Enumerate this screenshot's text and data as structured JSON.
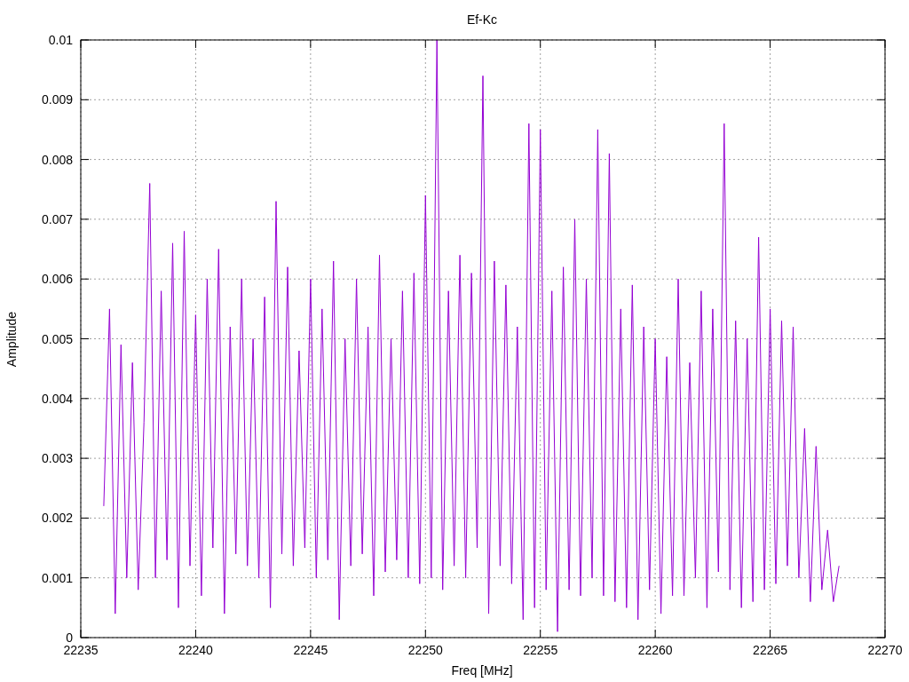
{
  "chart_data": {
    "type": "line",
    "title": "Ef-Kc",
    "xlabel": "Freq [MHz]",
    "ylabel": "Amplitude",
    "xlim": [
      22235,
      22270
    ],
    "ylim": [
      0,
      0.01
    ],
    "xticks": [
      22235,
      22240,
      22245,
      22250,
      22255,
      22260,
      22265,
      22270
    ],
    "yticks": [
      0,
      0.001,
      0.002,
      0.003,
      0.004,
      0.005,
      0.006,
      0.007,
      0.008,
      0.009,
      0.01
    ],
    "grid": true,
    "x": [
      22236,
      22236.25,
      22236.5,
      22236.75,
      22237,
      22237.25,
      22237.5,
      22237.75,
      22238,
      22238.25,
      22238.5,
      22238.75,
      22239,
      22239.25,
      22239.5,
      22239.75,
      22240,
      22240.25,
      22240.5,
      22240.75,
      22241,
      22241.25,
      22241.5,
      22241.75,
      22242,
      22242.25,
      22242.5,
      22242.75,
      22243,
      22243.25,
      22243.5,
      22243.75,
      22244,
      22244.25,
      22244.5,
      22244.75,
      22245,
      22245.25,
      22245.5,
      22245.75,
      22246,
      22246.25,
      22246.5,
      22246.75,
      22247,
      22247.25,
      22247.5,
      22247.75,
      22248,
      22248.25,
      22248.5,
      22248.75,
      22249,
      22249.25,
      22249.5,
      22249.75,
      22250,
      22250.25,
      22250.5,
      22250.75,
      22251,
      22251.25,
      22251.5,
      22251.75,
      22252,
      22252.25,
      22252.5,
      22252.75,
      22253,
      22253.25,
      22253.5,
      22253.75,
      22254,
      22254.25,
      22254.5,
      22254.75,
      22255,
      22255.25,
      22255.5,
      22255.75,
      22256,
      22256.25,
      22256.5,
      22256.75,
      22257,
      22257.25,
      22257.5,
      22257.75,
      22258,
      22258.25,
      22258.5,
      22258.75,
      22259,
      22259.25,
      22259.5,
      22259.75,
      22260,
      22260.25,
      22260.5,
      22260.75,
      22261,
      22261.25,
      22261.5,
      22261.75,
      22262,
      22262.25,
      22262.5,
      22262.75,
      22263,
      22263.25,
      22263.5,
      22263.75,
      22264,
      22264.25,
      22264.5,
      22264.75,
      22265,
      22265.25,
      22265.5,
      22265.75,
      22266,
      22266.25,
      22266.5,
      22266.75,
      22267,
      22267.25,
      22267.5,
      22267.75,
      22268
    ],
    "series": [
      {
        "color": "#9400d3",
        "values": [
          0.0022,
          0.0055,
          0.0004,
          0.0049,
          0.001,
          0.0046,
          0.0008,
          0.0036,
          0.0076,
          0.001,
          0.0058,
          0.0013,
          0.0066,
          0.0005,
          0.0068,
          0.0012,
          0.0054,
          0.0007,
          0.006,
          0.0015,
          0.0065,
          0.0004,
          0.0052,
          0.0014,
          0.006,
          0.0012,
          0.005,
          0.001,
          0.0057,
          0.0005,
          0.0073,
          0.0014,
          0.0062,
          0.0012,
          0.0048,
          0.0015,
          0.006,
          0.001,
          0.0055,
          0.0013,
          0.0063,
          0.0003,
          0.005,
          0.0012,
          0.006,
          0.0014,
          0.0052,
          0.0007,
          0.0064,
          0.0011,
          0.005,
          0.0013,
          0.0058,
          0.001,
          0.0061,
          0.0009,
          0.0074,
          0.001,
          0.01,
          0.0008,
          0.0058,
          0.0012,
          0.0064,
          0.001,
          0.0061,
          0.0015,
          0.0094,
          0.0004,
          0.0063,
          0.0012,
          0.0059,
          0.0009,
          0.0052,
          0.0003,
          0.0086,
          0.0005,
          0.0085,
          0.0008,
          0.0058,
          0.0001,
          0.0062,
          0.0008,
          0.007,
          0.0007,
          0.006,
          0.001,
          0.0085,
          0.0007,
          0.0081,
          0.0006,
          0.0055,
          0.0005,
          0.0059,
          0.0003,
          0.0052,
          0.0008,
          0.005,
          0.0004,
          0.0047,
          0.0007,
          0.006,
          0.0007,
          0.0046,
          0.001,
          0.0058,
          0.0005,
          0.0055,
          0.0011,
          0.0086,
          0.0008,
          0.0053,
          0.0005,
          0.005,
          0.0006,
          0.0067,
          0.0008,
          0.0055,
          0.0009,
          0.0053,
          0.0012,
          0.0052,
          0.001,
          0.0035,
          0.0006,
          0.0032,
          0.0008,
          0.0018,
          0.0006,
          0.0012
        ]
      }
    ]
  }
}
